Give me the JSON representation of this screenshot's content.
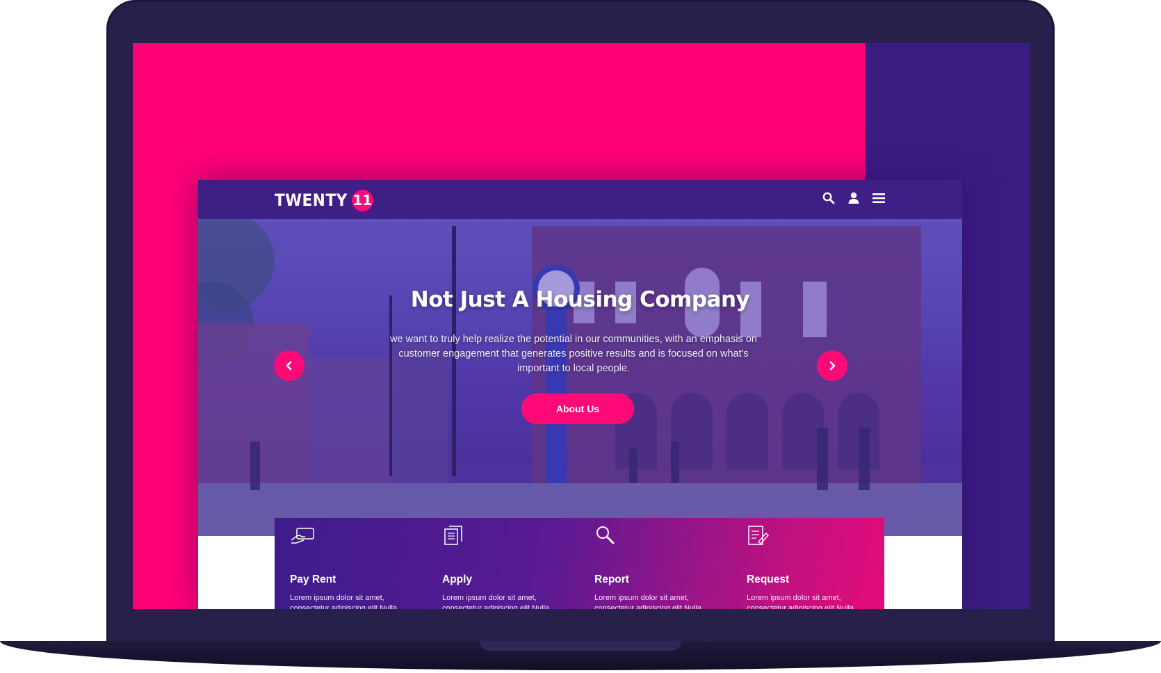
{
  "colors": {
    "brand_pink": "#ff0a77",
    "brand_purple": "#3d1f86"
  },
  "header": {
    "logo_text": "TWENTY",
    "logo_badge": "11",
    "icons": [
      "search-icon",
      "user-icon",
      "menu-icon"
    ]
  },
  "hero": {
    "title": "Not Just A Housing Company",
    "description": "we want to truly help realize the potential in our communities, with an emphasis on customer engagement that generates positive results and is focused on what's important to local people.",
    "button_label": "About Us"
  },
  "services": [
    {
      "icon": "hand-card-icon",
      "title": "Pay Rent",
      "desc": "Lorem ipsum dolor sit amet, consectetur adipiscing elit Nulla"
    },
    {
      "icon": "documents-icon",
      "title": "Apply",
      "desc": "Lorem ipsum dolor sit amet, consectetur adipiscing elit Nulla"
    },
    {
      "icon": "magnifier-icon",
      "title": "Report",
      "desc": "Lorem ipsum dolor sit amet, consectetur adipiscing elit Nulla"
    },
    {
      "icon": "form-edit-icon",
      "title": "Request",
      "desc": "Lorem ipsum dolor sit amet, consectetur adipiscing elit Nulla"
    }
  ]
}
